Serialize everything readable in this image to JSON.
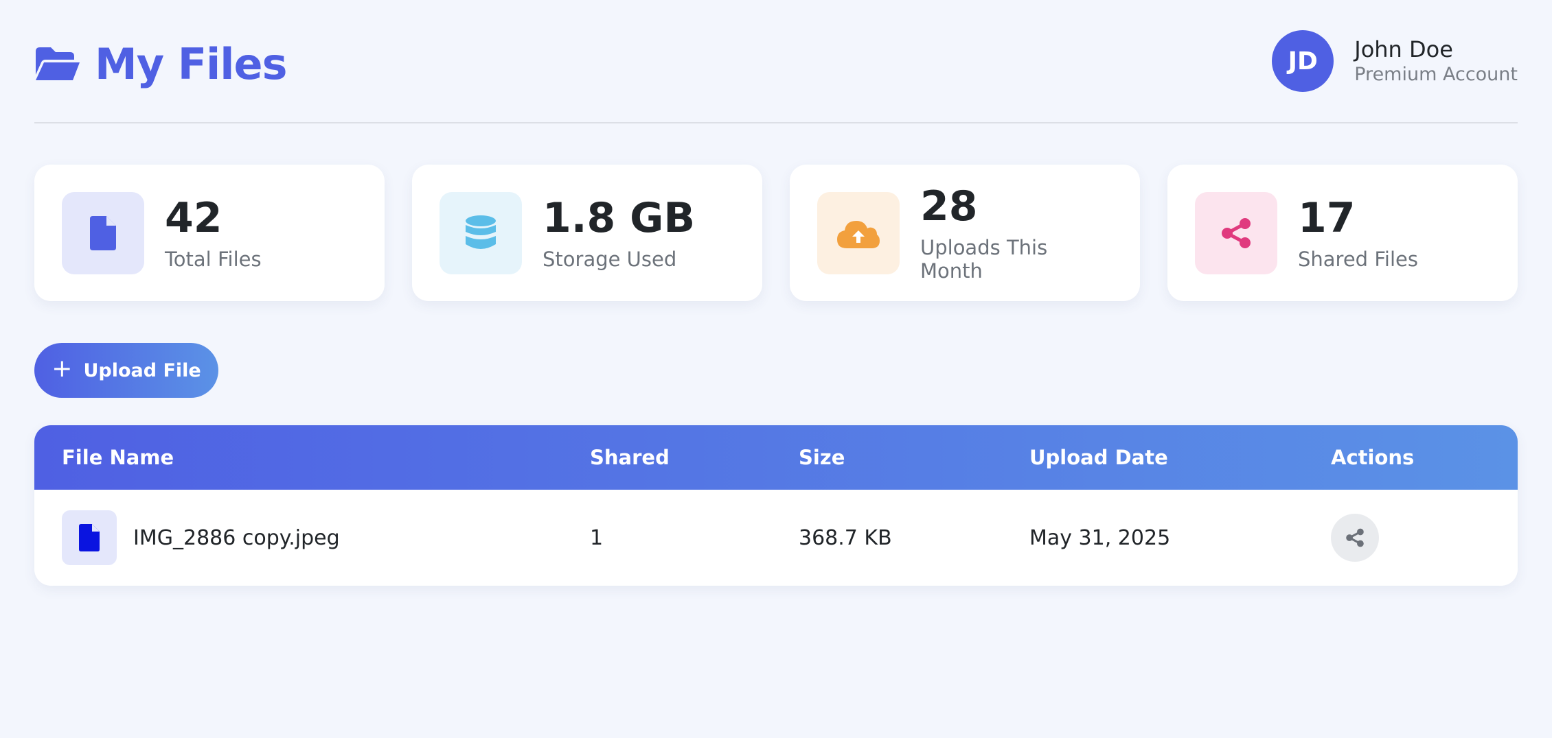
{
  "header": {
    "title": "My Files",
    "user": {
      "initials": "JD",
      "name": "John Doe",
      "plan": "Premium Account"
    }
  },
  "stats": [
    {
      "value": "42",
      "label": "Total Files",
      "icon": "file-icon",
      "color": "#4f60e3",
      "bg": "#e4e7fb"
    },
    {
      "value": "1.8 GB",
      "label": "Storage Used",
      "icon": "database-icon",
      "color": "#5bbde8",
      "bg": "#e6f4fb"
    },
    {
      "value": "28",
      "label": "Uploads This Month",
      "icon": "cloud-upload-icon",
      "color": "#f2a03d",
      "bg": "#fdf0e1"
    },
    {
      "value": "17",
      "label": "Shared Files",
      "icon": "share-icon",
      "color": "#e03a7e",
      "bg": "#fce4ee"
    }
  ],
  "upload_button": {
    "label": "Upload File",
    "icon": "plus-icon"
  },
  "table": {
    "columns": [
      "File Name",
      "Shared",
      "Size",
      "Upload Date",
      "Actions"
    ],
    "rows": [
      {
        "name": "IMG_2886 copy.jpeg",
        "shared": "1",
        "size": "368.7 KB",
        "date": "May 31, 2025",
        "action_icon": "share-icon"
      }
    ]
  },
  "colors": {
    "accent": "#4f60e3",
    "accent_end": "#5b92e6",
    "background": "#f3f6fd"
  }
}
